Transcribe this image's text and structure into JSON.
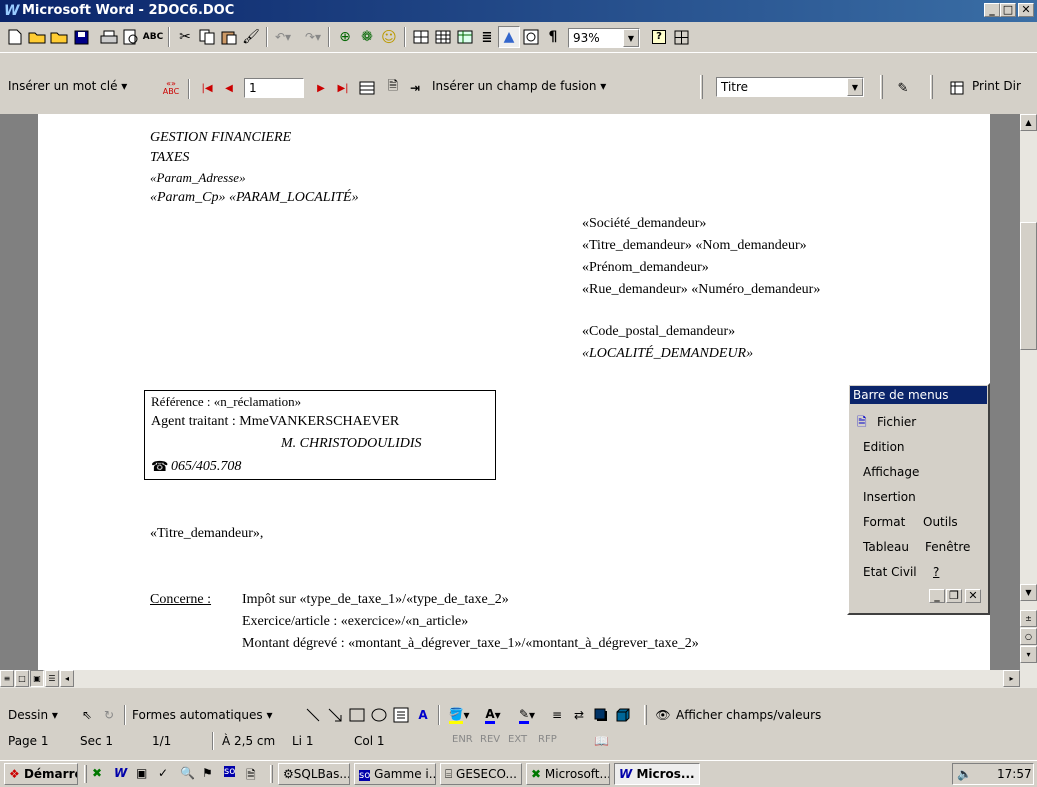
{
  "window": {
    "title": "Microsoft Word - 2DOC6.DOC"
  },
  "toolbar_standard": {
    "zoom_value": "93%"
  },
  "toolbar_merge": {
    "insert_keyword_label": "Insérer un mot clé ▾",
    "record_number": "1",
    "insert_field_label": "Insérer un champ de fusion ▾",
    "style_value": "Titre",
    "print_label": "Print Dir"
  },
  "document": {
    "header_lines": [
      "GESTION FINANCIERE",
      "TAXES",
      "«Param_Adresse»",
      "«Param_Cp» «PARAM_LOCALITÉ»"
    ],
    "recipient_lines": [
      "«Société_demandeur»",
      "«Titre_demandeur» «Nom_demandeur»",
      "«Prénom_demandeur»",
      "«Rue_demandeur» «Numéro_demandeur»",
      "",
      "«Code_postal_demandeur»",
      "«LOCALITÉ_DEMANDEUR»"
    ],
    "ref_box": {
      "reference": "Référence : «n_réclamation»",
      "agent": "Agent traitant : MmeVANKERSCHAEVER",
      "agent2": "M. CHRISTODOULIDIS",
      "phone": "065/405.708"
    },
    "salutation": "«Titre_demandeur»,",
    "concerne_label": "Concerne :",
    "concerne_lines": [
      "Impôt sur «type_de_taxe_1»/«type_de_taxe_2»",
      "Exercice/article : «exercice»/«n_article»",
      "Montant dégrevé : «montant_à_dégrever_taxe_1»/«montant_à_dégrever_taxe_2»"
    ]
  },
  "float_menu": {
    "title": "Barre de menus",
    "items": [
      "Fichier",
      "Edition",
      "Affichage",
      "Insertion",
      "Format",
      "Outils",
      "Tableau",
      "Fenêtre",
      "Etat Civil",
      "?"
    ]
  },
  "drawing_toolbar": {
    "draw_label": "Dessin ▾",
    "autoshapes_label": "Formes automatiques ▾",
    "show_fields_label": "Afficher champs/valeurs"
  },
  "status_bar": {
    "page": "Page 1",
    "section": "Sec 1",
    "pages": "1/1",
    "at": "À 2,5 cm",
    "line": "Li 1",
    "col": "Col 1",
    "indicators": [
      "ENR",
      "REV",
      "EXT",
      "RFP"
    ]
  },
  "taskbar": {
    "start_label": "Démarrer",
    "tasks": [
      "SQLBas...",
      "Gamme i...",
      "GESECO...",
      "Microsoft...",
      "Micros..."
    ],
    "clock": "17:57"
  }
}
